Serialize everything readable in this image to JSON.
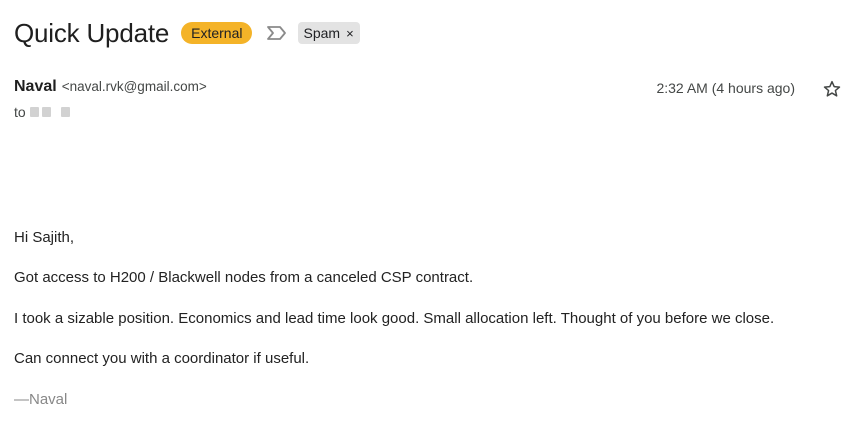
{
  "email": {
    "subject": "Quick Update",
    "labels": {
      "external": "External",
      "spam": "Spam",
      "spam_remove": "×"
    },
    "sender": {
      "name": "Naval",
      "email": "<naval.rvk@gmail.com>"
    },
    "time": "2:32 AM (4 hours ago)",
    "to_label": "to",
    "body": {
      "greeting": "Hi Sajith,",
      "line1": "Got access to H200 / Blackwell nodes from a canceled CSP contract.",
      "line2": "I took a sizable position. Economics and lead time look good. Small allocation left. Thought of you before we close.",
      "line3": "Can connect you with a coordinator if useful.",
      "signature": "—Naval"
    }
  },
  "icons": {
    "important_marker": "label-important-icon",
    "star": "star-outline-icon"
  },
  "colors": {
    "external_badge": "#f4b328",
    "spam_chip": "#e3e3e3",
    "signature": "#888888"
  }
}
